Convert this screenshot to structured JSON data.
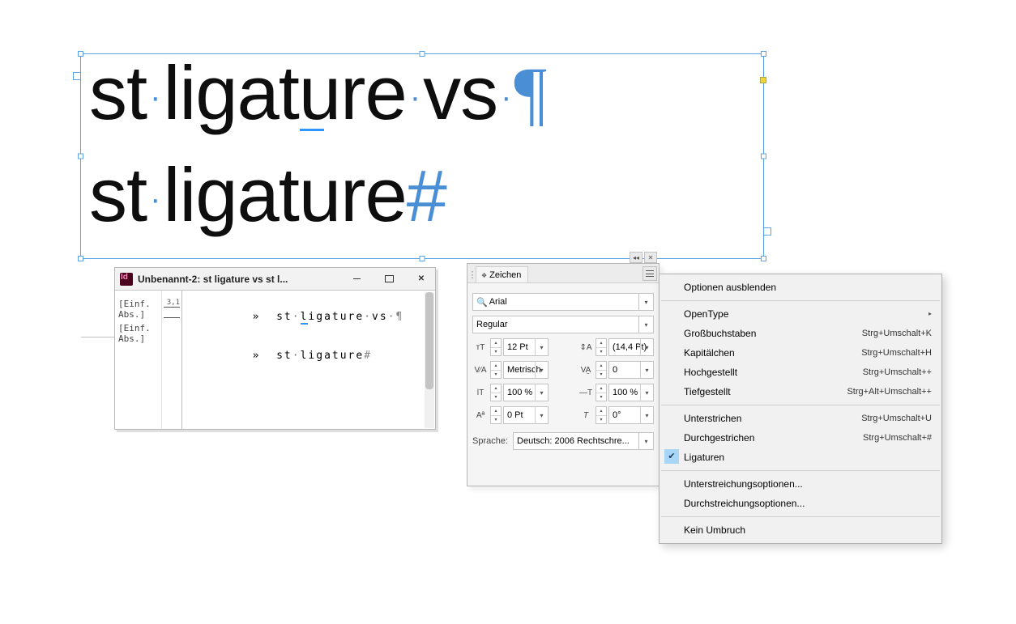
{
  "canvas": {
    "line1_word1": "st",
    "line1_word2": "ligature",
    "line1_word3": "vs",
    "line1_pilcrow": "¶",
    "line2_word1": "st",
    "line2_word2": "ligature",
    "line2_hash": "#"
  },
  "story_editor": {
    "title": "Unbenannt-2: st ligature vs  st l...",
    "para_label_1": "[Einf. Abs.]",
    "para_label_2": "[Einf. Abs.]",
    "ruler_val": "3,1",
    "row1_text": "st ligature vs ",
    "row1_pilcrow": "¶",
    "row2_text": "st ligature",
    "row2_hash": "#"
  },
  "char_panel": {
    "tab_title": "Zeichen",
    "font_family": "Arial",
    "font_style": "Regular",
    "font_size": "12 Pt",
    "leading": "(14,4 Pt)",
    "kerning": "Metrisch",
    "tracking": "0",
    "v_scale": "100 %",
    "h_scale": "100 %",
    "baseline_shift": "0 Pt",
    "skew": "0°",
    "language_label": "Sprache:",
    "language_value": "Deutsch: 2006 Rechtschre..."
  },
  "flyout": {
    "hide_options": "Optionen ausblenden",
    "opentype": "OpenType",
    "uppercase": {
      "label": "Großbuchstaben",
      "shortcut": "Strg+Umschalt+K"
    },
    "smallcaps": {
      "label": "Kapitälchen",
      "shortcut": "Strg+Umschalt+H"
    },
    "superscript": {
      "label": "Hochgestellt",
      "shortcut": "Strg+Umschalt++"
    },
    "subscript": {
      "label": "Tiefgestellt",
      "shortcut": "Strg+Alt+Umschalt++"
    },
    "underline": {
      "label": "Unterstrichen",
      "shortcut": "Strg+Umschalt+U"
    },
    "strikethrough": {
      "label": "Durchgestrichen",
      "shortcut": "Strg+Umschalt+#"
    },
    "ligatures": "Ligaturen",
    "underline_opts": "Unterstreichungsoptionen...",
    "strike_opts": "Durchstreichungsoptionen...",
    "no_break": "Kein Umbruch"
  }
}
